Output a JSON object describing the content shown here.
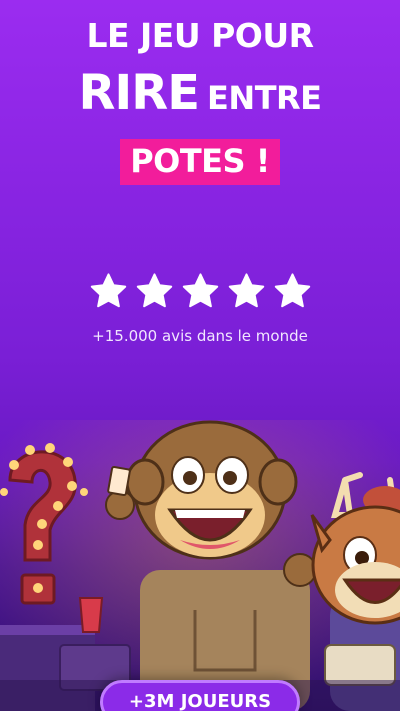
{
  "headline": {
    "line1": "LE JEU POUR",
    "line2_big": "RIRE",
    "line2_small": "ENTRE",
    "line3_highlight": "POTES !"
  },
  "rating": {
    "stars": 5,
    "reviews_text": "+15.000 avis dans le monde"
  },
  "cta": {
    "label": "+3M JOUEURS"
  },
  "colors": {
    "background_top": "#9b2cf0",
    "background_bottom": "#2f0f6a",
    "highlight": "#f21d9b",
    "star": "#ffffff",
    "cta": "#8b2be8"
  },
  "illustration": {
    "characters": [
      "monkey-character",
      "deer-character"
    ],
    "props": [
      "question-mark-marquee-sign",
      "red-cup"
    ]
  }
}
